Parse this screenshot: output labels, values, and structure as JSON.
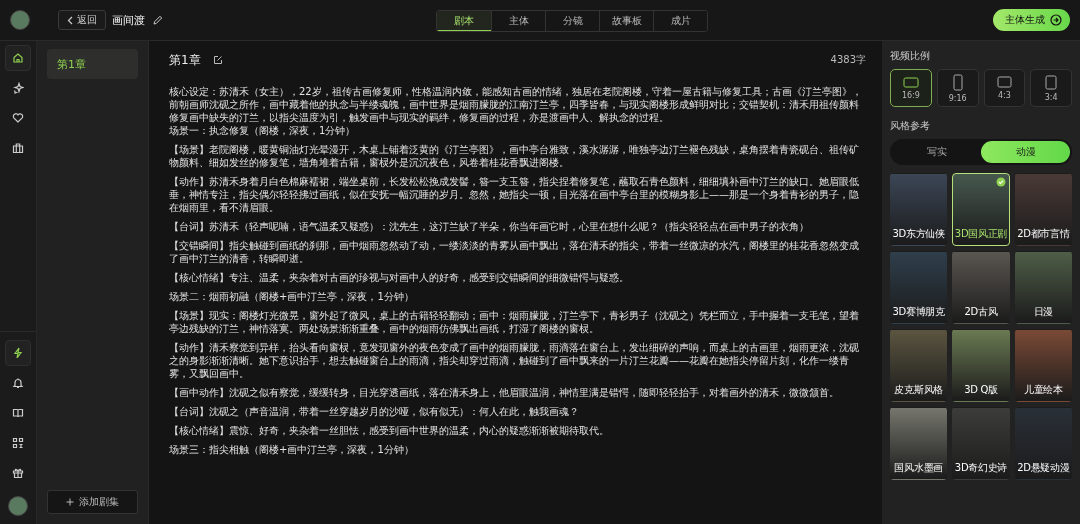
{
  "topbar": {
    "back": "返回",
    "title": "画间渡",
    "tabs": [
      {
        "label": "剧本",
        "selected": true
      },
      {
        "label": "主体",
        "selected": false
      },
      {
        "label": "分镜",
        "selected": false
      },
      {
        "label": "故事板",
        "selected": false
      },
      {
        "label": "成片",
        "selected": false
      }
    ],
    "action": "主体生成"
  },
  "rail": {
    "top": [
      {
        "selected": true
      },
      {
        "selected": false
      },
      {
        "selected": false
      },
      {
        "selected": false
      }
    ],
    "bottom": [
      {
        "selected": true
      },
      {
        "selected": false
      },
      {
        "selected": false
      },
      {
        "selected": false
      },
      {
        "selected": false
      }
    ]
  },
  "chapters": {
    "items": [
      {
        "label": "第1章",
        "selected": true
      }
    ],
    "add": "添加剧集"
  },
  "editor": {
    "title": "第1章",
    "count": "4383字",
    "blocks": [
      [
        "核心设定：苏清禾（女主），22岁，祖传古画修复师，性格温润内敛，能感知古画的情绪，独居在老院阁楼，守着一屋古籍与修复工具；古画《汀兰亭图》，前朝画师沈砚之所作，画中藏着他的执念与半缕魂魄，画中世界是烟雨朦胧的江南汀兰亭，四季皆春，与现实阁楼形成鲜明对比；交错契机：清禾用祖传颜料修复画中缺失的汀兰，以指尖温度为引，触发画中与现实的羁绊，修复画的过程，亦是渡画中人、解执念的过程。",
        "场景一：执念修复（阁楼，深夜，1分钟）"
      ],
      [
        "【场景】老院阁楼，暖黄铜油灯光晕漫开，木桌上铺着泛黄的《汀兰亭图》，画中亭台雅致，溪水潺潺，唯独亭边汀兰褪色残缺，桌角摆着青瓷砚台、祖传矿物颜料、细如发丝的修复笔，墙角堆着古籍，窗棂外是沉沉夜色，风卷着桂花香飘进阁楼。"
      ],
      [
        "【动作】苏清禾身着月白色棉麻襦裙，端坐桌前，长发松松挽成发髻，簪一支玉簪，指尖捏着修复笔，蘸取石青色颜料，细细填补画中汀兰的缺口。她眉眼低垂，神情专注，指尖偶尔轻轻拂过画纸，似在安抚一幅沉睡的岁月。忽然，她指尖一顿，目光落在画中亭台里的模糊身影上——那是一个身着青衫的男子，隐在烟雨里，看不清眉眼。"
      ],
      [
        "【台词】苏清禾（轻声呢喃，语气温柔又疑惑）：沈先生，这汀兰缺了半朵，你当年画它时，心里在想什么呢？（指尖轻轻点在画中男子的衣角）"
      ],
      [
        "【交错瞬间】指尖触碰到画纸的刹那，画中烟雨忽然动了动，一缕淡淡的青雾从画中飘出，落在清禾的指尖，带着一丝微凉的水汽，阁楼里的桂花香忽然变成了画中汀兰的清香，转瞬即逝。"
      ],
      [
        "【核心情绪】专注、温柔，夹杂着对古画的珍视与对画中人的好奇，感受到交错瞬间的细微错愕与疑惑。"
      ],
      [
        "场景二：烟雨初融（阁楼+画中汀兰亭，深夜，1分钟）"
      ],
      [
        "【场景】现实：阁楼灯光微晃，窗外起了微风，桌上的古籍轻轻翻动；画中：烟雨朦胧，汀兰亭下，青衫男子（沈砚之）凭栏而立，手中握着一支毛笔，望着亭边残缺的汀兰，神情落寞。两处场景渐渐重叠，画中的烟雨仿佛飘出画纸，打湿了阁楼的窗棂。"
      ],
      [
        "【动作】清禾察觉到异样，抬头看向窗棂，竟发现窗外的夜色变成了画中的烟雨朦胧，雨滴落在窗台上，发出细碎的声响，而桌上的古画里，烟雨更浓，沈砚之的身影渐渐清晰。她下意识抬手，想去触碰窗台上的雨滴，指尖却穿过雨滴，触碰到了画中飘来的一片汀兰花瓣——花瓣在她指尖停留片刻，化作一缕青雾，又飘回画中。"
      ],
      [
        "【画中动作】沈砚之似有察觉，缓缓转身，目光穿透画纸，落在清禾身上，他眉眼温润，神情里满是错愕，随即轻轻抬手，对着画外的清禾，微微颔首。"
      ],
      [
        "【台词】沈砚之（声音温润，带着一丝穿越岁月的沙哑，似有似无）：何人在此，触我画魂？"
      ],
      [
        "【核心情绪】震惊、好奇，夹杂着一丝胆怯，感受到画中世界的温柔，内心的疑惑渐渐被期待取代。"
      ],
      [
        "场景三：指尖相触（阁楼+画中汀兰亭，深夜，1分钟）"
      ]
    ]
  },
  "panel": {
    "ratio_title": "视频比例",
    "ratios": [
      {
        "label": "16:9",
        "kind": "wide",
        "selected": true
      },
      {
        "label": "9:16",
        "kind": "tall",
        "selected": false
      },
      {
        "label": "4:3",
        "kind": "landscape",
        "selected": false
      },
      {
        "label": "3:4",
        "kind": "portrait",
        "selected": false
      }
    ],
    "style_title": "风格参考",
    "style_modes": [
      {
        "label": "写实",
        "selected": false
      },
      {
        "label": "动漫",
        "selected": true
      }
    ],
    "styles": [
      {
        "label": "3D东方仙侠",
        "selected": false
      },
      {
        "label": "3D国风正剧",
        "selected": true
      },
      {
        "label": "2D都市言情",
        "selected": false
      },
      {
        "label": "3D赛博朋克",
        "selected": false
      },
      {
        "label": "2D古风",
        "selected": false
      },
      {
        "label": "日漫",
        "selected": false
      },
      {
        "label": "皮克斯风格",
        "selected": false
      },
      {
        "label": "3D Q版",
        "selected": false
      },
      {
        "label": "儿童绘本",
        "selected": false
      },
      {
        "label": "国风水墨画",
        "selected": false
      },
      {
        "label": "3D奇幻史诗",
        "selected": false
      },
      {
        "label": "2D悬疑动漫",
        "selected": false
      }
    ]
  }
}
